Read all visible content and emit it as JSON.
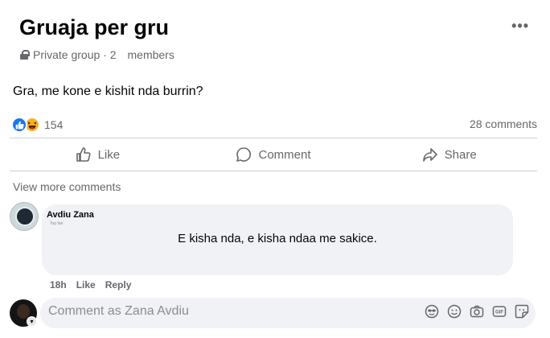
{
  "group": {
    "title": "Gruaja per gru",
    "privacy": "Private group · 2",
    "members_label": "members"
  },
  "post": {
    "text": "Gra, me kone e kishit nda burrin?",
    "reaction_count": "154",
    "comments_count": "28 comments",
    "reactions": [
      "like-icon",
      "haha-icon"
    ]
  },
  "actions": {
    "like": "Like",
    "comment": "Comment",
    "share": "Share"
  },
  "comments_section": {
    "view_more": "View more comments",
    "comment": {
      "author": "Avdiu Zana",
      "author_sub": "Top fan",
      "text": "E kisha nda, e kisha ndaa me sakice.",
      "time": "18h",
      "like": "Like",
      "reply": "Reply"
    }
  },
  "composer": {
    "placeholder": "Comment as Zana Avdiu",
    "icons": [
      "avatar-sticker-icon",
      "emoji-icon",
      "camera-icon",
      "gif-icon",
      "sticker-icon"
    ]
  },
  "colors": {
    "like_blue": "#1877f2",
    "haha_yellow": "#f7b125",
    "secondary_text": "#65676b",
    "bubble_bg": "#f0f2f5"
  }
}
